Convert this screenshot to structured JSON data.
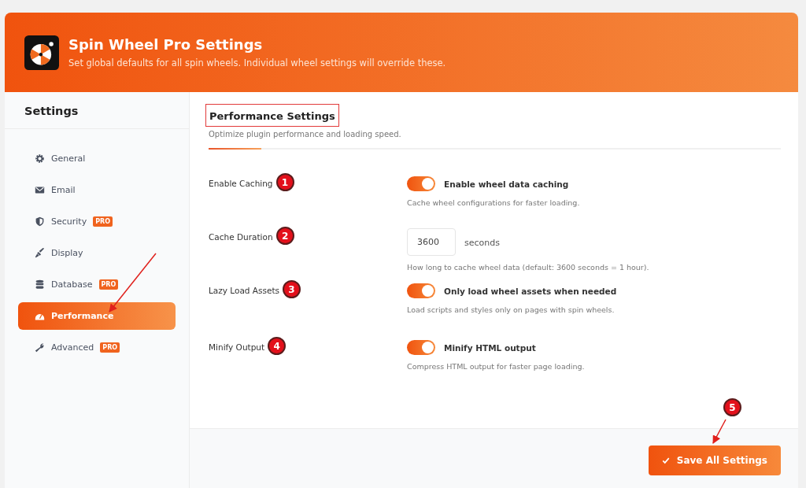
{
  "header": {
    "title": "Spin Wheel Pro Settings",
    "subtitle": "Set global defaults for all spin wheels. Individual wheel settings will override these."
  },
  "sidebar": {
    "title": "Settings",
    "items": [
      {
        "label": "General",
        "selected": false
      },
      {
        "label": "Email",
        "selected": false
      },
      {
        "label": "Security",
        "badge": "PRO",
        "selected": false
      },
      {
        "label": "Display",
        "selected": false
      },
      {
        "label": "Database",
        "badge": "PRO",
        "selected": false
      },
      {
        "label": "Performance",
        "selected": true
      },
      {
        "label": "Advanced",
        "badge": "PRO",
        "selected": false
      }
    ]
  },
  "section": {
    "title": "Performance Settings",
    "description": "Optimize plugin performance and loading speed."
  },
  "settings": [
    {
      "label": "Enable Caching",
      "marker": "1",
      "kind": "toggle",
      "on": true,
      "option": "Enable wheel data caching",
      "help": "Cache wheel configurations for faster loading."
    },
    {
      "label": "Cache Duration",
      "marker": "2",
      "kind": "number",
      "value": "3600",
      "unit": "seconds",
      "help": "How long to cache wheel data (default: 3600 seconds = 1 hour)."
    },
    {
      "label": "Lazy Load Assets",
      "marker": "3",
      "kind": "toggle",
      "on": true,
      "option": "Only load wheel assets when needed",
      "help": "Load scripts and styles only on pages with spin wheels."
    },
    {
      "label": "Minify Output",
      "marker": "4",
      "kind": "toggle",
      "on": true,
      "option": "Minify HTML output",
      "help": "Compress HTML output for faster page loading."
    }
  ],
  "footer": {
    "save_button": "Save All Settings",
    "marker": "5"
  }
}
